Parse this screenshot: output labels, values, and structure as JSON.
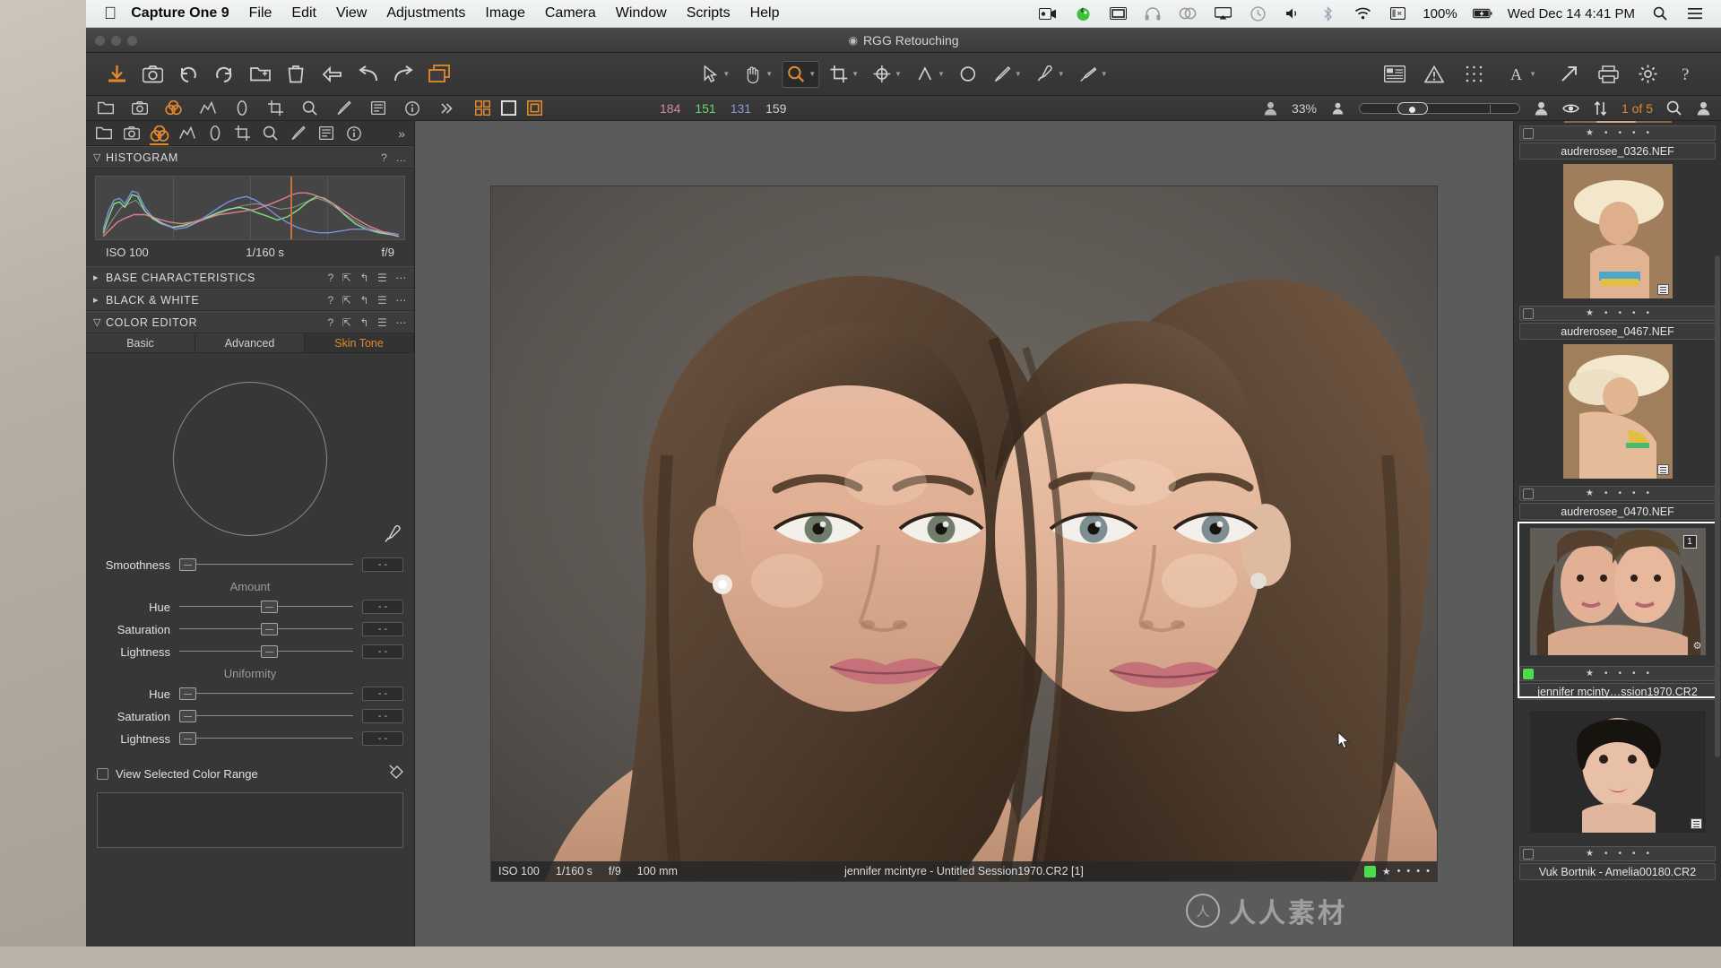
{
  "menubar": {
    "apple": "apple-logo",
    "app_name": "Capture One 9",
    "items": [
      "File",
      "Edit",
      "View",
      "Adjustments",
      "Image",
      "Camera",
      "Window",
      "Scripts",
      "Help"
    ],
    "status_icons": [
      "screen-record-icon",
      "app-green-icon",
      "display-icon",
      "headphones-icon",
      "creative-cloud-icon",
      "airplay-icon",
      "time-machine-icon",
      "volume-icon",
      "bluetooth-icon",
      "wifi-icon",
      "keyboard-input-icon"
    ],
    "battery_percent": "100%",
    "battery_icon": "battery-charging-icon",
    "clock": "Wed Dec 14  4:41 PM",
    "spotlight_icon": "search-icon",
    "notification_icon": "menu-list-icon"
  },
  "window": {
    "title": "RGG Retouching",
    "title_icon": "session-icon"
  },
  "toolbar": {
    "left_tools": [
      {
        "name": "import-images-button",
        "icon": "download-arrow-icon"
      },
      {
        "name": "capture-button",
        "icon": "camera-icon"
      },
      {
        "name": "undo-button",
        "icon": "rotate-left-icon"
      },
      {
        "name": "redo-button",
        "icon": "rotate-right-icon"
      },
      {
        "name": "create-album-button",
        "icon": "folder-plus-icon"
      },
      {
        "name": "delete-button",
        "icon": "trash-icon"
      },
      {
        "name": "reset-adjustments-button",
        "icon": "back-arrow-icon"
      },
      {
        "name": "copy-apply-button",
        "icon": "curve-arrow-left-icon"
      },
      {
        "name": "apply-adjustments-button",
        "icon": "curve-arrow-right-icon"
      },
      {
        "name": "variants-button",
        "icon": "layers-icon"
      }
    ],
    "center_tools": [
      {
        "name": "select-tool",
        "icon": "cursor-arrow-icon",
        "active": false
      },
      {
        "name": "pan-tool",
        "icon": "hand-icon",
        "active": false
      },
      {
        "name": "zoom-tool",
        "icon": "magnifier-icon",
        "active": true
      },
      {
        "name": "crop-tool",
        "icon": "crop-icon",
        "active": false
      },
      {
        "name": "rotate-tool",
        "icon": "rotate-crosshair-icon",
        "active": false
      },
      {
        "name": "keystone-tool",
        "icon": "keystone-icon",
        "active": false
      },
      {
        "name": "spot-removal-tool",
        "icon": "circle-icon",
        "active": false
      },
      {
        "name": "draw-mask-tool",
        "icon": "brush-icon",
        "active": false
      },
      {
        "name": "color-picker-tool",
        "icon": "eyedropper-icon",
        "active": false
      },
      {
        "name": "erase-mask-tool",
        "icon": "eraser-brush-icon",
        "active": false
      }
    ],
    "right_tools": [
      {
        "name": "proof-profile-button",
        "icon": "proof-icon"
      },
      {
        "name": "exposure-warning-button",
        "icon": "warning-triangle-icon"
      },
      {
        "name": "focus-mask-button",
        "icon": "grid-dots-icon"
      },
      {
        "name": "annotations-button",
        "icon": "letter-a-icon"
      },
      {
        "name": "process-recipes-button",
        "icon": "export-arrow-icon"
      },
      {
        "name": "print-button",
        "icon": "printer-icon"
      },
      {
        "name": "preferences-button",
        "icon": "gear-icon"
      },
      {
        "name": "help-button",
        "icon": "question-mark-icon"
      }
    ]
  },
  "secondbar": {
    "tools": [
      {
        "name": "library-tab-icon",
        "icon": "folder-icon",
        "active": false
      },
      {
        "name": "capture-tab-icon",
        "icon": "camera-icon",
        "active": false
      },
      {
        "name": "color-tab-icon",
        "icon": "color-circles-icon",
        "active": true
      },
      {
        "name": "exposure-tab-icon",
        "icon": "histogram-peak-icon",
        "active": false
      },
      {
        "name": "lens-tab-icon",
        "icon": "lens-icon",
        "active": false
      },
      {
        "name": "composition-tab-icon",
        "icon": "crop-icon",
        "active": false
      },
      {
        "name": "details-tab-icon",
        "icon": "magnifier-icon",
        "active": false
      },
      {
        "name": "adjustments-tab-icon",
        "icon": "brush-icon",
        "active": false
      },
      {
        "name": "metadata-tab-icon",
        "icon": "list-icon",
        "active": false
      },
      {
        "name": "output-tab-icon",
        "icon": "info-icon",
        "active": false
      },
      {
        "name": "more-tabs-icon",
        "icon": "chevron-right-icon",
        "active": false
      }
    ],
    "view_modes": [
      {
        "name": "grid-view-button",
        "icon": "grid-squares-icon",
        "active": false
      },
      {
        "name": "single-view-button",
        "icon": "single-square-icon",
        "active": false
      },
      {
        "name": "multi-view-button",
        "icon": "nested-square-icon",
        "active": true
      }
    ],
    "readout": {
      "r": "184",
      "g": "151",
      "b": "131",
      "k": "159"
    },
    "zoom_percent": "33%",
    "browse_counter": "1 of 5",
    "right_icons": [
      "person-icon",
      "eye-icon",
      "sort-arrows-icon",
      "search-icon",
      "user-icon"
    ]
  },
  "left_panel": {
    "tabs": [
      {
        "name": "tool-tab-library",
        "icon": "folder-icon",
        "active": false
      },
      {
        "name": "tool-tab-capture",
        "icon": "camera-icon",
        "active": false
      },
      {
        "name": "tool-tab-color",
        "icon": "color-circles-icon",
        "active": true
      },
      {
        "name": "tool-tab-exposure",
        "icon": "histogram-icon",
        "active": false
      },
      {
        "name": "tool-tab-lens",
        "icon": "lens-icon",
        "active": false
      },
      {
        "name": "tool-tab-composition",
        "icon": "crop-icon",
        "active": false
      },
      {
        "name": "tool-tab-details",
        "icon": "magnifier-icon",
        "active": false
      },
      {
        "name": "tool-tab-adjustments",
        "icon": "brush-icon",
        "active": false
      },
      {
        "name": "tool-tab-metadata",
        "icon": "list-icon",
        "active": false
      },
      {
        "name": "tool-tab-output",
        "icon": "info-icon",
        "active": false
      }
    ],
    "more_label": "»",
    "histogram": {
      "title": "HISTOGRAM",
      "help_icon": "?",
      "menu_icon": "…",
      "iso": "ISO 100",
      "shutter": "1/160 s",
      "aperture": "f/9"
    },
    "sections": [
      {
        "title": "BASE CHARACTERISTICS",
        "expanded": false
      },
      {
        "title": "BLACK & WHITE",
        "expanded": false
      },
      {
        "title": "COLOR EDITOR",
        "expanded": true
      }
    ],
    "color_editor": {
      "tabs": [
        {
          "label": "Basic",
          "active": false
        },
        {
          "label": "Advanced",
          "active": false
        },
        {
          "label": "Skin Tone",
          "active": true
        }
      ],
      "picker_icon": "eyedropper-icon",
      "smoothness": {
        "label": "Smoothness",
        "value": "- -",
        "knob_pct": 2
      },
      "amount_group": "Amount",
      "amount": [
        {
          "label": "Hue",
          "value": "- -",
          "knob_pct": 50
        },
        {
          "label": "Saturation",
          "value": "- -",
          "knob_pct": 50
        },
        {
          "label": "Lightness",
          "value": "- -",
          "knob_pct": 50
        }
      ],
      "uniformity_group": "Uniformity",
      "uniformity": [
        {
          "label": "Hue",
          "value": "- -",
          "knob_pct": 2
        },
        {
          "label": "Saturation",
          "value": "- -",
          "knob_pct": 2
        },
        {
          "label": "Lightness",
          "value": "- -",
          "knob_pct": 2
        }
      ],
      "view_range_label": "View Selected Color Range",
      "view_range_checked": false,
      "spray_icon": "spray-can-icon"
    }
  },
  "viewer": {
    "status": {
      "iso": "ISO 100",
      "shutter": "1/160 s",
      "aperture": "f/9",
      "focal": "100 mm",
      "filename": "jennifer mcintyre - Untitled Session1970.CR2 [1]",
      "color_tag": "#4cdd4c",
      "rating_star": "★",
      "rating_dots": 4
    }
  },
  "browser": {
    "thumbnails": [
      {
        "name": "audrerosee_0326.NEF",
        "color_tag": "none",
        "star": "★",
        "dots": 4,
        "selected": false,
        "variant_badge": false,
        "partial_top": true
      },
      {
        "name": "audrerosee_0467.NEF",
        "color_tag": "none",
        "star": "★",
        "dots": 4,
        "selected": false,
        "variant_badge": true
      },
      {
        "name": "audrerosee_0470.NEF",
        "color_tag": "none",
        "star": "★",
        "dots": 4,
        "selected": false,
        "variant_badge": true
      },
      {
        "name": "jennifer mcinty…ssion1970.CR2",
        "color_tag": "#4cdd4c",
        "star": "★",
        "dots": 4,
        "selected": true,
        "badge_number": "1",
        "variant_badge": false
      },
      {
        "name": "Vuk Bortnik - Amelia00180.CR2",
        "color_tag": "none",
        "star": "★",
        "dots": 4,
        "selected": false,
        "variant_badge": true
      }
    ]
  },
  "watermark": {
    "logo_letter": "人",
    "text": "人人素材"
  },
  "colors": {
    "accent": "#e08a2e",
    "panel_bg": "#373737",
    "toolbar_bg": "#3a3a3a",
    "viewer_bg": "#5b5b5b",
    "text": "#dcdcdc",
    "green_tag": "#4cdd4c"
  }
}
